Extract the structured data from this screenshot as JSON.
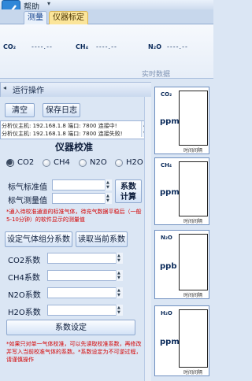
{
  "menu": {
    "help": "帮助",
    "arrow": "▾"
  },
  "tabs": {
    "measure": "测量",
    "calibration": "仪器标定"
  },
  "readings": {
    "co2": {
      "label": "CO₂",
      "value": "----.--"
    },
    "ch4": {
      "label": "CH₄",
      "value": "----.--"
    },
    "n2o": {
      "label": "N₂O",
      "value": "----.--"
    },
    "caption": "实时数据"
  },
  "panel": {
    "title": "运行操作",
    "collapse_icon": "◂"
  },
  "actions": {
    "clear": "清空",
    "save_log": "保存日志"
  },
  "log": [
    "分析仪主机: 192.168.1.8 端口: 7800 连接中!",
    "分析仪主机: 192.168.1.8 端口: 7800 连接失败!"
  ],
  "calibration": {
    "title": "仪器校准",
    "gases": [
      {
        "label": "CO2",
        "checked": true
      },
      {
        "label": "CH4",
        "checked": false
      },
      {
        "label": "N2O",
        "checked": false
      },
      {
        "label": "H2O",
        "checked": false
      }
    ],
    "std_value_label": "标气标准值",
    "measured_value_label": "标气测量值",
    "coef_calc_line1": "系数",
    "coef_calc_line2": "计算",
    "note": "*通入待校准通道的标准气体，待充气数据平稳后（一般5-10分钟）的软件显示的测量值",
    "set_gas_coef": "设定气体组分系数",
    "read_current_coef": "读取当前系数",
    "coefs": [
      {
        "label": "CO2系数"
      },
      {
        "label": "CH4系数"
      },
      {
        "label": "N2O系数"
      },
      {
        "label": "H2O系数"
      }
    ],
    "coef_setting": "系数设定",
    "note2": "*如果只对单一气体校准，可以先读取校准系数，再修改并写入当前校准气体的系数。*系数设定为不可逆过程，请谨慎操作"
  },
  "charts": [
    {
      "gas": "CO₂",
      "unit": "ppm",
      "x_label": "时间间隔"
    },
    {
      "gas": "CH₄",
      "unit": "ppm",
      "x_label": "时间间隔"
    },
    {
      "gas": "N₂O",
      "unit": "ppb",
      "x_label": "时间间隔"
    },
    {
      "gas": "H₂O",
      "unit": "ppm",
      "x_label": "时间间隔"
    }
  ]
}
